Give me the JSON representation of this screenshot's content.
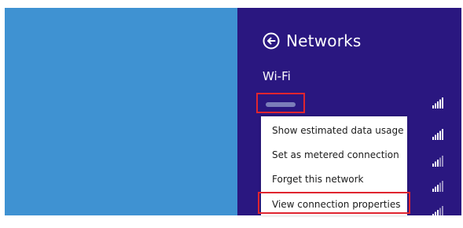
{
  "panel": {
    "title": "Networks",
    "back_icon": "back-arrow-circle-icon",
    "section_label": "Wi-Fi"
  },
  "colors": {
    "desktop": "#3f92d2",
    "charm": "#2a1780",
    "highlight": "#e0252f",
    "menu_bg": "#ffffff"
  },
  "networks": [
    {
      "name_redacted": true,
      "signal_icon": "wifi-signal-icon",
      "selected": true
    },
    {
      "signal_icon": "wifi-signal-icon"
    },
    {
      "signal_icon": "wifi-signal-icon"
    },
    {
      "signal_icon": "wifi-signal-icon"
    },
    {
      "signal_icon": "wifi-signal-icon"
    }
  ],
  "context_menu": {
    "items": [
      {
        "label": "Show estimated data usage"
      },
      {
        "label": "Set as metered connection"
      },
      {
        "label": "Forget this network"
      },
      {
        "label": "View connection properties",
        "highlighted": true
      }
    ]
  }
}
